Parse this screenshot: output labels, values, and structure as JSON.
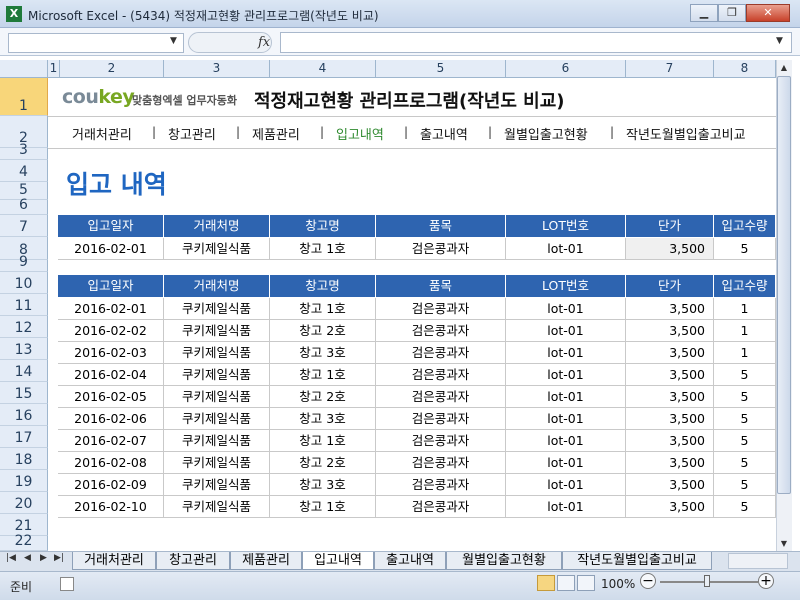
{
  "window": {
    "title": "Microsoft Excel - (5434) 적정재고현황 관리프로그램(작년도 비교)",
    "app_icon": "X"
  },
  "formula_bar": {
    "name_box": "",
    "fx": "fx",
    "formula": ""
  },
  "columns": [
    "1",
    "2",
    "3",
    "4",
    "5",
    "6",
    "7",
    "8"
  ],
  "rows": [
    "1",
    "2",
    "3",
    "4",
    "5",
    "6",
    "7",
    "8",
    "9",
    "10",
    "11",
    "12",
    "13",
    "14",
    "15",
    "16",
    "17",
    "18",
    "19",
    "20",
    "21",
    "22"
  ],
  "sheet": {
    "logo_text_1": "cou",
    "logo_text_2": "key",
    "logo_tagline": "맞춤형엑셀 업무자동화",
    "program_title": "적정재고현황 관리프로그램(작년도 비교)",
    "nav": [
      "거래처관리",
      "창고관리",
      "제품관리",
      "입고내역",
      "출고내역",
      "월별입출고현황",
      "작년도월별입출고비교"
    ],
    "nav_separator": "|",
    "section_title": "입고 내역",
    "table_headers": [
      "입고일자",
      "거래처명",
      "창고명",
      "품목",
      "LOT번호",
      "단가",
      "입고수량"
    ],
    "input_row": [
      "2016-02-01",
      "쿠키제일식품",
      "창고 1호",
      "검은콩과자",
      "lot-01",
      "3,500",
      "5"
    ],
    "records": [
      [
        "2016-02-01",
        "쿠키제일식품",
        "창고 1호",
        "검은콩과자",
        "lot-01",
        "3,500",
        "1"
      ],
      [
        "2016-02-02",
        "쿠키제일식품",
        "창고 2호",
        "검은콩과자",
        "lot-01",
        "3,500",
        "1"
      ],
      [
        "2016-02-03",
        "쿠키제일식품",
        "창고 3호",
        "검은콩과자",
        "lot-01",
        "3,500",
        "1"
      ],
      [
        "2016-02-04",
        "쿠키제일식품",
        "창고 1호",
        "검은콩과자",
        "lot-01",
        "3,500",
        "5"
      ],
      [
        "2016-02-05",
        "쿠키제일식품",
        "창고 2호",
        "검은콩과자",
        "lot-01",
        "3,500",
        "5"
      ],
      [
        "2016-02-06",
        "쿠키제일식품",
        "창고 3호",
        "검은콩과자",
        "lot-01",
        "3,500",
        "5"
      ],
      [
        "2016-02-07",
        "쿠키제일식품",
        "창고 1호",
        "검은콩과자",
        "lot-01",
        "3,500",
        "5"
      ],
      [
        "2016-02-08",
        "쿠키제일식품",
        "창고 2호",
        "검은콩과자",
        "lot-01",
        "3,500",
        "5"
      ],
      [
        "2016-02-09",
        "쿠키제일식품",
        "창고 3호",
        "검은콩과자",
        "lot-01",
        "3,500",
        "5"
      ],
      [
        "2016-02-10",
        "쿠키제일식품",
        "창고 1호",
        "검은콩과자",
        "lot-01",
        "3,500",
        "5"
      ]
    ]
  },
  "sheet_tabs": [
    "거래처관리",
    "창고관리",
    "제품관리",
    "입고내역",
    "출고내역",
    "월별입출고현황",
    "작년도월별입출고비교"
  ],
  "status": {
    "ready": "준비",
    "zoom": "100%",
    "zoom_minus": "−",
    "zoom_plus": "+"
  },
  "colors": {
    "header_blue": "#2e64b0",
    "title_blue": "#1f66c1",
    "active_nav_green": "#2f8a2f",
    "logo_green": "#78a722"
  }
}
